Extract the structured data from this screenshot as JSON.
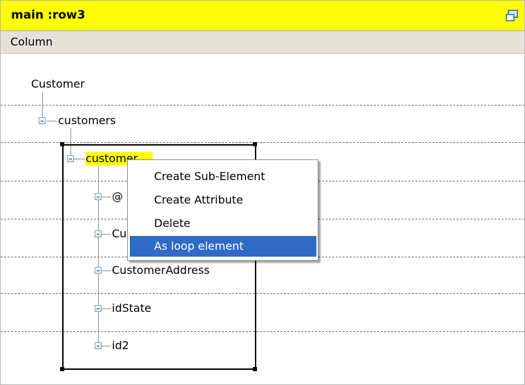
{
  "header": {
    "title": "main :row3"
  },
  "column_header": {
    "label": "Column"
  },
  "tree": {
    "root": "Customer",
    "nodes": {
      "customers": "customers",
      "customer": "customer",
      "attr": "@",
      "cust_partial": "Cu",
      "address": "CustomerAddress",
      "state": "idState",
      "id2": "id2"
    }
  },
  "context_menu": {
    "items": [
      "Create Sub-Element",
      "Create Attribute",
      "Delete",
      "As loop element"
    ],
    "selected_index": 3
  }
}
